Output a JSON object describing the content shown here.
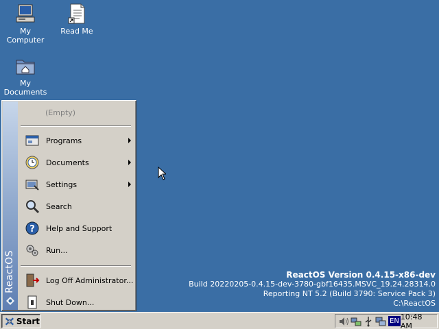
{
  "desktop": {
    "icons": [
      {
        "label_line1": "My",
        "label_line2": "Computer",
        "icon": "computer-icon"
      },
      {
        "label_line1": "Read Me",
        "label_line2": "",
        "icon": "document-icon"
      },
      {
        "label_line1": "My",
        "label_line2": "Documents",
        "icon": "folder-documents-icon"
      }
    ],
    "background_color": "#3a6ea5"
  },
  "start_menu": {
    "brand": "ReactOS",
    "recent_empty": "(Empty)",
    "items": [
      {
        "label": "Programs",
        "icon": "programs-icon",
        "submenu": true
      },
      {
        "label": "Documents",
        "icon": "documents-icon",
        "submenu": true
      },
      {
        "label": "Settings",
        "icon": "settings-icon",
        "submenu": true
      },
      {
        "label": "Search",
        "icon": "search-icon",
        "submenu": false
      },
      {
        "label": "Help and Support",
        "icon": "help-icon",
        "submenu": false
      },
      {
        "label": "Run...",
        "icon": "run-icon",
        "submenu": false
      }
    ],
    "bottom_items": [
      {
        "label": "Log Off Administrator...",
        "icon": "logoff-icon"
      },
      {
        "label": "Shut Down...",
        "icon": "shutdown-icon"
      }
    ]
  },
  "version_info": {
    "title": "ReactOS Version 0.4.15-x86-dev",
    "build": "Build 20220205-0.4.15-dev-3780-gbf16435.MSVC_19.24.28314.0",
    "reporting": "Reporting NT 5.2 (Build 3790: Service Pack 3)",
    "path": "C:\\ReactOS"
  },
  "taskbar": {
    "start_label": "Start",
    "language": "EN",
    "clock": "10:48 AM",
    "tray_icons": [
      "volume-icon",
      "network-icon",
      "usb-icon",
      "display-icon"
    ]
  }
}
